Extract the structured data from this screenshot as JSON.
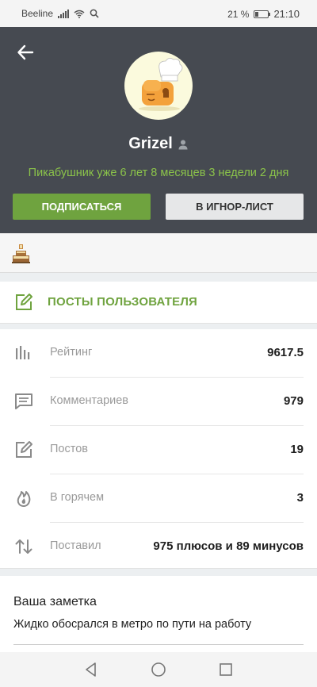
{
  "status_bar": {
    "carrier": "Beeline",
    "battery_percent": "21 %",
    "time": "21:10"
  },
  "profile": {
    "username": "Grizel",
    "tenure": "Пикабушник уже 6 лет 8 месяцев 3 недели 2 дня",
    "subscribe_label": "ПОДПИСАТЬСЯ",
    "ignore_label": "В ИГНОР-ЛИСТ"
  },
  "posts_link": {
    "label": "ПОСТЫ ПОЛЬЗОВАТЕЛЯ"
  },
  "stats": [
    {
      "icon": "bar-chart-icon",
      "label": "Рейтинг",
      "value": "9617.5"
    },
    {
      "icon": "comment-icon",
      "label": "Комментариев",
      "value": "979"
    },
    {
      "icon": "edit-icon",
      "label": "Постов",
      "value": "19"
    },
    {
      "icon": "fire-icon",
      "label": "В горячем",
      "value": "3"
    },
    {
      "icon": "up-down-arrows-icon",
      "label": "Поставил",
      "value": "975 плюсов и 89 минусов"
    }
  ],
  "note": {
    "title": "Ваша заметка",
    "text": "Жидко обосрался в метро по пути на работу"
  },
  "colors": {
    "header_bg": "#464a51",
    "accent_green": "#6fa33f",
    "tenure_green": "#8bc34a"
  }
}
